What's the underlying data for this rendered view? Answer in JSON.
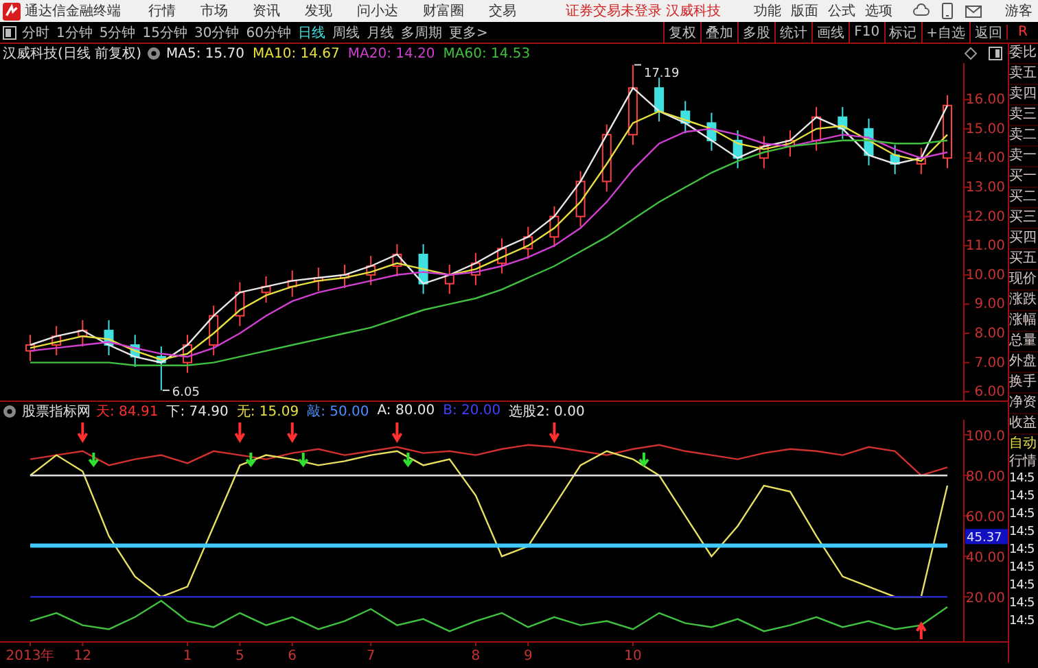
{
  "app_bar": {
    "title": "通达信金融终端",
    "menus": [
      "行情",
      "市场",
      "资讯",
      "发现",
      "问小达",
      "财富圈",
      "交易"
    ],
    "notice": "证券交易未登录  汉威科技",
    "tools": [
      "功能",
      "版面",
      "公式",
      "选项"
    ],
    "user": "游客"
  },
  "toolbar": {
    "periods": [
      {
        "label": "分时",
        "selected": false
      },
      {
        "label": "1分钟",
        "selected": false
      },
      {
        "label": "5分钟",
        "selected": false
      },
      {
        "label": "15分钟",
        "selected": false
      },
      {
        "label": "30分钟",
        "selected": false
      },
      {
        "label": "60分钟",
        "selected": false
      },
      {
        "label": "日线",
        "selected": true
      },
      {
        "label": "周线",
        "selected": false
      },
      {
        "label": "月线",
        "selected": false
      },
      {
        "label": "多周期",
        "selected": false
      },
      {
        "label": "更多>",
        "selected": false
      }
    ],
    "actions": [
      "复权",
      "叠加",
      "多股",
      "统计",
      "画线",
      "F10",
      "标记",
      "+自选",
      "返回"
    ],
    "corner": "R"
  },
  "price_chart": {
    "title": "汉威科技(日线 前复权)",
    "legend": [
      {
        "label": "MA5: 15.70",
        "color": "#e8e8e8"
      },
      {
        "label": "MA10: 14.67",
        "color": "#e8e040"
      },
      {
        "label": "MA20: 14.20",
        "color": "#d040d0"
      },
      {
        "label": "MA60: 14.53",
        "color": "#40c040"
      }
    ],
    "chart_data": {
      "type": "candlestick",
      "categories": [
        null,
        null,
        null,
        null,
        null,
        null,
        null,
        null,
        null,
        null,
        null,
        null,
        null,
        null,
        null,
        null,
        null,
        null,
        null,
        null,
        null,
        null,
        null,
        null,
        null,
        null,
        null,
        null,
        null,
        null,
        null,
        null,
        null,
        null,
        null,
        null
      ],
      "ylim": [
        5.7,
        17.25
      ],
      "yticks": [
        {
          "value": 6,
          "label": "6.00"
        },
        {
          "value": 7,
          "label": "7.00"
        },
        {
          "value": 8,
          "label": "8.00"
        },
        {
          "value": 9,
          "label": "9.00"
        },
        {
          "value": 10,
          "label": "10.00"
        },
        {
          "value": 11,
          "label": "11.00"
        },
        {
          "value": 12,
          "label": "12.00"
        },
        {
          "value": 13,
          "label": "13.00"
        },
        {
          "value": 14,
          "label": "14.00"
        },
        {
          "value": 15,
          "label": "15.00"
        },
        {
          "value": 16,
          "label": "16.00"
        }
      ],
      "ohlc": [
        [
          7.4,
          7.95,
          7.05,
          7.6
        ],
        [
          7.6,
          8.25,
          7.25,
          7.9
        ],
        [
          7.9,
          8.45,
          7.55,
          8.1
        ],
        [
          8.1,
          8.45,
          7.25,
          7.6
        ],
        [
          7.6,
          7.95,
          6.85,
          7.2
        ],
        [
          7.2,
          7.55,
          6.05,
          7.0
        ],
        [
          7.0,
          7.95,
          6.65,
          7.6
        ],
        [
          7.6,
          8.95,
          7.25,
          8.6
        ],
        [
          8.6,
          9.75,
          8.25,
          9.4
        ],
        [
          9.4,
          9.95,
          9.05,
          9.6
        ],
        [
          9.6,
          10.15,
          9.25,
          9.8
        ],
        [
          9.8,
          10.25,
          9.45,
          9.9
        ],
        [
          9.9,
          10.35,
          9.55,
          10.0
        ],
        [
          10.0,
          10.65,
          9.65,
          10.3
        ],
        [
          10.3,
          11.05,
          9.95,
          10.7
        ],
        [
          10.7,
          11.05,
          9.35,
          9.7
        ],
        [
          9.7,
          10.35,
          9.35,
          10.0
        ],
        [
          10.0,
          10.75,
          9.65,
          10.4
        ],
        [
          10.4,
          11.25,
          10.05,
          10.9
        ],
        [
          10.9,
          11.65,
          10.55,
          11.3
        ],
        [
          11.3,
          12.35,
          10.95,
          12.0
        ],
        [
          12.0,
          13.55,
          11.65,
          13.2
        ],
        [
          13.2,
          15.15,
          12.85,
          14.8
        ],
        [
          14.8,
          17.19,
          14.45,
          16.4
        ],
        [
          16.4,
          16.75,
          15.25,
          15.6
        ],
        [
          15.6,
          15.95,
          14.85,
          15.2
        ],
        [
          15.2,
          15.55,
          14.25,
          14.6
        ],
        [
          14.6,
          14.95,
          13.65,
          14.0
        ],
        [
          14.0,
          14.75,
          13.65,
          14.4
        ],
        [
          14.4,
          14.95,
          14.05,
          14.6
        ],
        [
          14.6,
          15.75,
          14.25,
          15.4
        ],
        [
          15.4,
          15.75,
          14.65,
          15.0
        ],
        [
          15.0,
          15.35,
          13.75,
          14.1
        ],
        [
          14.1,
          14.45,
          13.45,
          13.8
        ],
        [
          13.8,
          14.35,
          13.45,
          14.0
        ],
        [
          14.0,
          16.15,
          13.65,
          15.8
        ]
      ],
      "series": [
        {
          "type": "line",
          "color": "#e8e8e8",
          "values": [
            7.6,
            7.9,
            8.1,
            7.6,
            7.2,
            7.0,
            7.6,
            8.6,
            9.4,
            9.6,
            9.8,
            9.9,
            10.0,
            10.3,
            10.7,
            9.7,
            10.0,
            10.4,
            10.9,
            11.3,
            12.0,
            13.2,
            14.8,
            16.4,
            15.6,
            15.2,
            14.6,
            14.0,
            14.4,
            14.6,
            15.4,
            15.0,
            14.1,
            13.8,
            14.0,
            15.8
          ]
        },
        {
          "type": "line",
          "color": "#e8e040",
          "values": [
            7.5,
            7.7,
            7.9,
            7.8,
            7.4,
            7.1,
            7.3,
            8.0,
            8.8,
            9.3,
            9.6,
            9.8,
            9.9,
            10.1,
            10.4,
            10.2,
            10.0,
            10.2,
            10.6,
            11.0,
            11.6,
            12.5,
            13.8,
            15.2,
            15.6,
            15.3,
            15.0,
            14.5,
            14.3,
            14.5,
            15.0,
            15.1,
            14.6,
            14.1,
            13.9,
            14.8
          ]
        },
        {
          "type": "line",
          "color": "#d040d0",
          "values": [
            7.4,
            7.5,
            7.6,
            7.7,
            7.5,
            7.3,
            7.2,
            7.5,
            8.0,
            8.6,
            9.1,
            9.4,
            9.6,
            9.8,
            10.0,
            10.1,
            10.0,
            10.1,
            10.3,
            10.6,
            11.0,
            11.6,
            12.5,
            13.6,
            14.5,
            14.9,
            15.0,
            14.8,
            14.5,
            14.4,
            14.6,
            14.8,
            14.7,
            14.3,
            14.0,
            14.2
          ]
        },
        {
          "type": "line",
          "color": "#40c040",
          "values": [
            7.0,
            7.0,
            7.0,
            7.0,
            6.9,
            6.9,
            6.9,
            7.0,
            7.2,
            7.4,
            7.6,
            7.8,
            8.0,
            8.2,
            8.5,
            8.8,
            9.0,
            9.2,
            9.5,
            9.9,
            10.3,
            10.8,
            11.3,
            11.9,
            12.5,
            13.0,
            13.5,
            13.9,
            14.2,
            14.4,
            14.5,
            14.6,
            14.6,
            14.5,
            14.5,
            14.6
          ]
        }
      ],
      "annotations": [
        "17.19",
        "6.05"
      ]
    }
  },
  "indicator": {
    "title": "股票指标网",
    "legend": [
      {
        "label": "天: 84.91",
        "color": "#ff3030"
      },
      {
        "label": "下: 74.90",
        "color": "#e8e8e8"
      },
      {
        "label": "无: 15.09",
        "color": "#e8e040"
      },
      {
        "label": "敲: 50.00",
        "color": "#4a90ff"
      },
      {
        "label": "A: 80.00",
        "color": "#e8e8e8"
      },
      {
        "label": "B: 20.00",
        "color": "#4040ff"
      },
      {
        "label": "选股2: 0.00",
        "color": "#e8e8e8"
      }
    ],
    "chart_data": {
      "type": "line",
      "categories": [
        "2013年",
        null,
        "12",
        null,
        null,
        null,
        "1",
        null,
        "5",
        null,
        "6",
        null,
        null,
        "7",
        null,
        null,
        null,
        "8",
        null,
        "9",
        null,
        null,
        null,
        "10",
        null,
        null,
        null,
        null,
        null,
        null,
        null,
        null,
        null,
        null,
        null,
        null
      ],
      "ylim": [
        -2.3,
        107.5
      ],
      "yticks": [
        {
          "value": 20,
          "label": "20.00"
        },
        {
          "value": 40,
          "label": "40.00"
        },
        {
          "value": 60,
          "label": "60.00"
        },
        {
          "value": 80,
          "label": "80.00"
        },
        {
          "value": 100,
          "label": "100.0"
        }
      ],
      "series": [
        {
          "color": "#d03030",
          "values": [
            88,
            90,
            92,
            85,
            88,
            90,
            86,
            92,
            90,
            88,
            91,
            93,
            90,
            92,
            94,
            91,
            92,
            90,
            93,
            95,
            94,
            92,
            90,
            93,
            95,
            92,
            90,
            88,
            91,
            93,
            92,
            90,
            94,
            92,
            80,
            84
          ]
        },
        {
          "color": "#e8e060",
          "values": [
            80,
            90,
            82,
            50,
            30,
            20,
            25,
            55,
            85,
            90,
            88,
            85,
            87,
            90,
            92,
            85,
            88,
            70,
            40,
            45,
            65,
            85,
            92,
            88,
            80,
            60,
            40,
            55,
            75,
            72,
            50,
            30,
            25,
            20,
            20,
            75
          ]
        },
        {
          "color": "#40c040",
          "values": [
            8,
            12,
            6,
            4,
            10,
            18,
            8,
            5,
            12,
            6,
            10,
            4,
            8,
            14,
            6,
            9,
            3,
            8,
            12,
            5,
            10,
            6,
            8,
            4,
            12,
            7,
            5,
            9,
            3,
            6,
            10,
            5,
            8,
            4,
            6,
            15
          ]
        },
        {
          "color": "#e0e0e0",
          "values": [
            80,
            80,
            80,
            80,
            80,
            80,
            80,
            80,
            80,
            80,
            80,
            80,
            80,
            80,
            80,
            80,
            80,
            80,
            80,
            80,
            80,
            80,
            80,
            80,
            80,
            80,
            80,
            80,
            80,
            80,
            80,
            80,
            80,
            80,
            80,
            80
          ]
        },
        {
          "color": "#2828c8",
          "values": [
            20,
            20,
            20,
            20,
            20,
            20,
            20,
            20,
            20,
            20,
            20,
            20,
            20,
            20,
            20,
            20,
            20,
            20,
            20,
            20,
            20,
            20,
            20,
            20,
            20,
            20,
            20,
            20,
            20,
            20,
            20,
            20,
            20,
            20,
            20,
            20
          ]
        },
        {
          "color": "#40c8ff",
          "values": [
            45.37,
            45.37,
            45.37,
            45.37,
            45.37,
            45.37,
            45.37,
            45.37,
            45.37,
            45.37,
            45.37,
            45.37,
            45.37,
            45.37,
            45.37,
            45.37,
            45.37,
            45.37,
            45.37,
            45.37,
            45.37,
            45.37,
            45.37,
            45.37,
            45.37,
            45.37,
            45.37,
            45.37,
            45.37,
            45.37,
            45.37,
            45.37,
            45.37,
            45.37,
            45.37,
            45.37
          ]
        }
      ],
      "annotations": [
        "45.37"
      ]
    }
  },
  "quote_panel": {
    "labels": [
      "委比",
      "卖五",
      "卖四",
      "卖三",
      "卖二",
      "卖一",
      "买一",
      "买二",
      "买三",
      "买四",
      "买五",
      "现价",
      "涨跌",
      "涨幅",
      "总量",
      "外盘",
      "换手",
      "净资",
      "收益"
    ],
    "mode": "自动",
    "mode_2": "行情",
    "times": [
      "14:5",
      "14:5",
      "14:5",
      "14:5",
      "14:5",
      "14:5",
      "14:5",
      "14:5",
      "14:5"
    ]
  }
}
